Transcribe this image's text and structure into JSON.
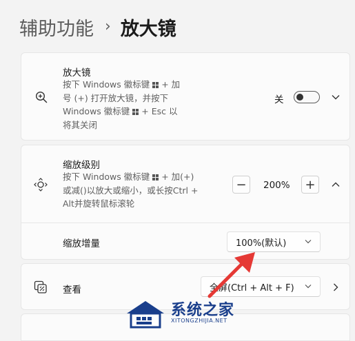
{
  "breadcrumb": {
    "parent": "辅助功能",
    "separator": "›",
    "current": "放大镜"
  },
  "magnifier": {
    "title": "放大镜",
    "desc": [
      "按下 Windows 徽标键",
      "+ 加",
      "号 (+) 打开放大镜，并按下",
      "Windows 徽标键",
      "+ Esc 以",
      "将其关闭"
    ],
    "toggle_label": "关",
    "toggle_on": false
  },
  "zoom_level": {
    "title": "缩放级别",
    "desc": [
      "按下 Windows 徽标键",
      "+ 加(+)",
      "或减()以放大或缩小，或长按Ctrl +",
      "Alt并旋转鼠标滚轮"
    ],
    "minus": "−",
    "value": "200%",
    "plus": "+"
  },
  "zoom_increment": {
    "label": "缩放增量",
    "selected": "100%(默认)"
  },
  "view": {
    "label": "查看",
    "selected": "全屏(Ctrl + Alt + F)"
  },
  "watermark": {
    "cn": "系统之家",
    "en": "XITONGZHIJIA.NET"
  },
  "colors": {
    "accent_arrow": "#e53935",
    "watermark": "#1a3f8c"
  }
}
